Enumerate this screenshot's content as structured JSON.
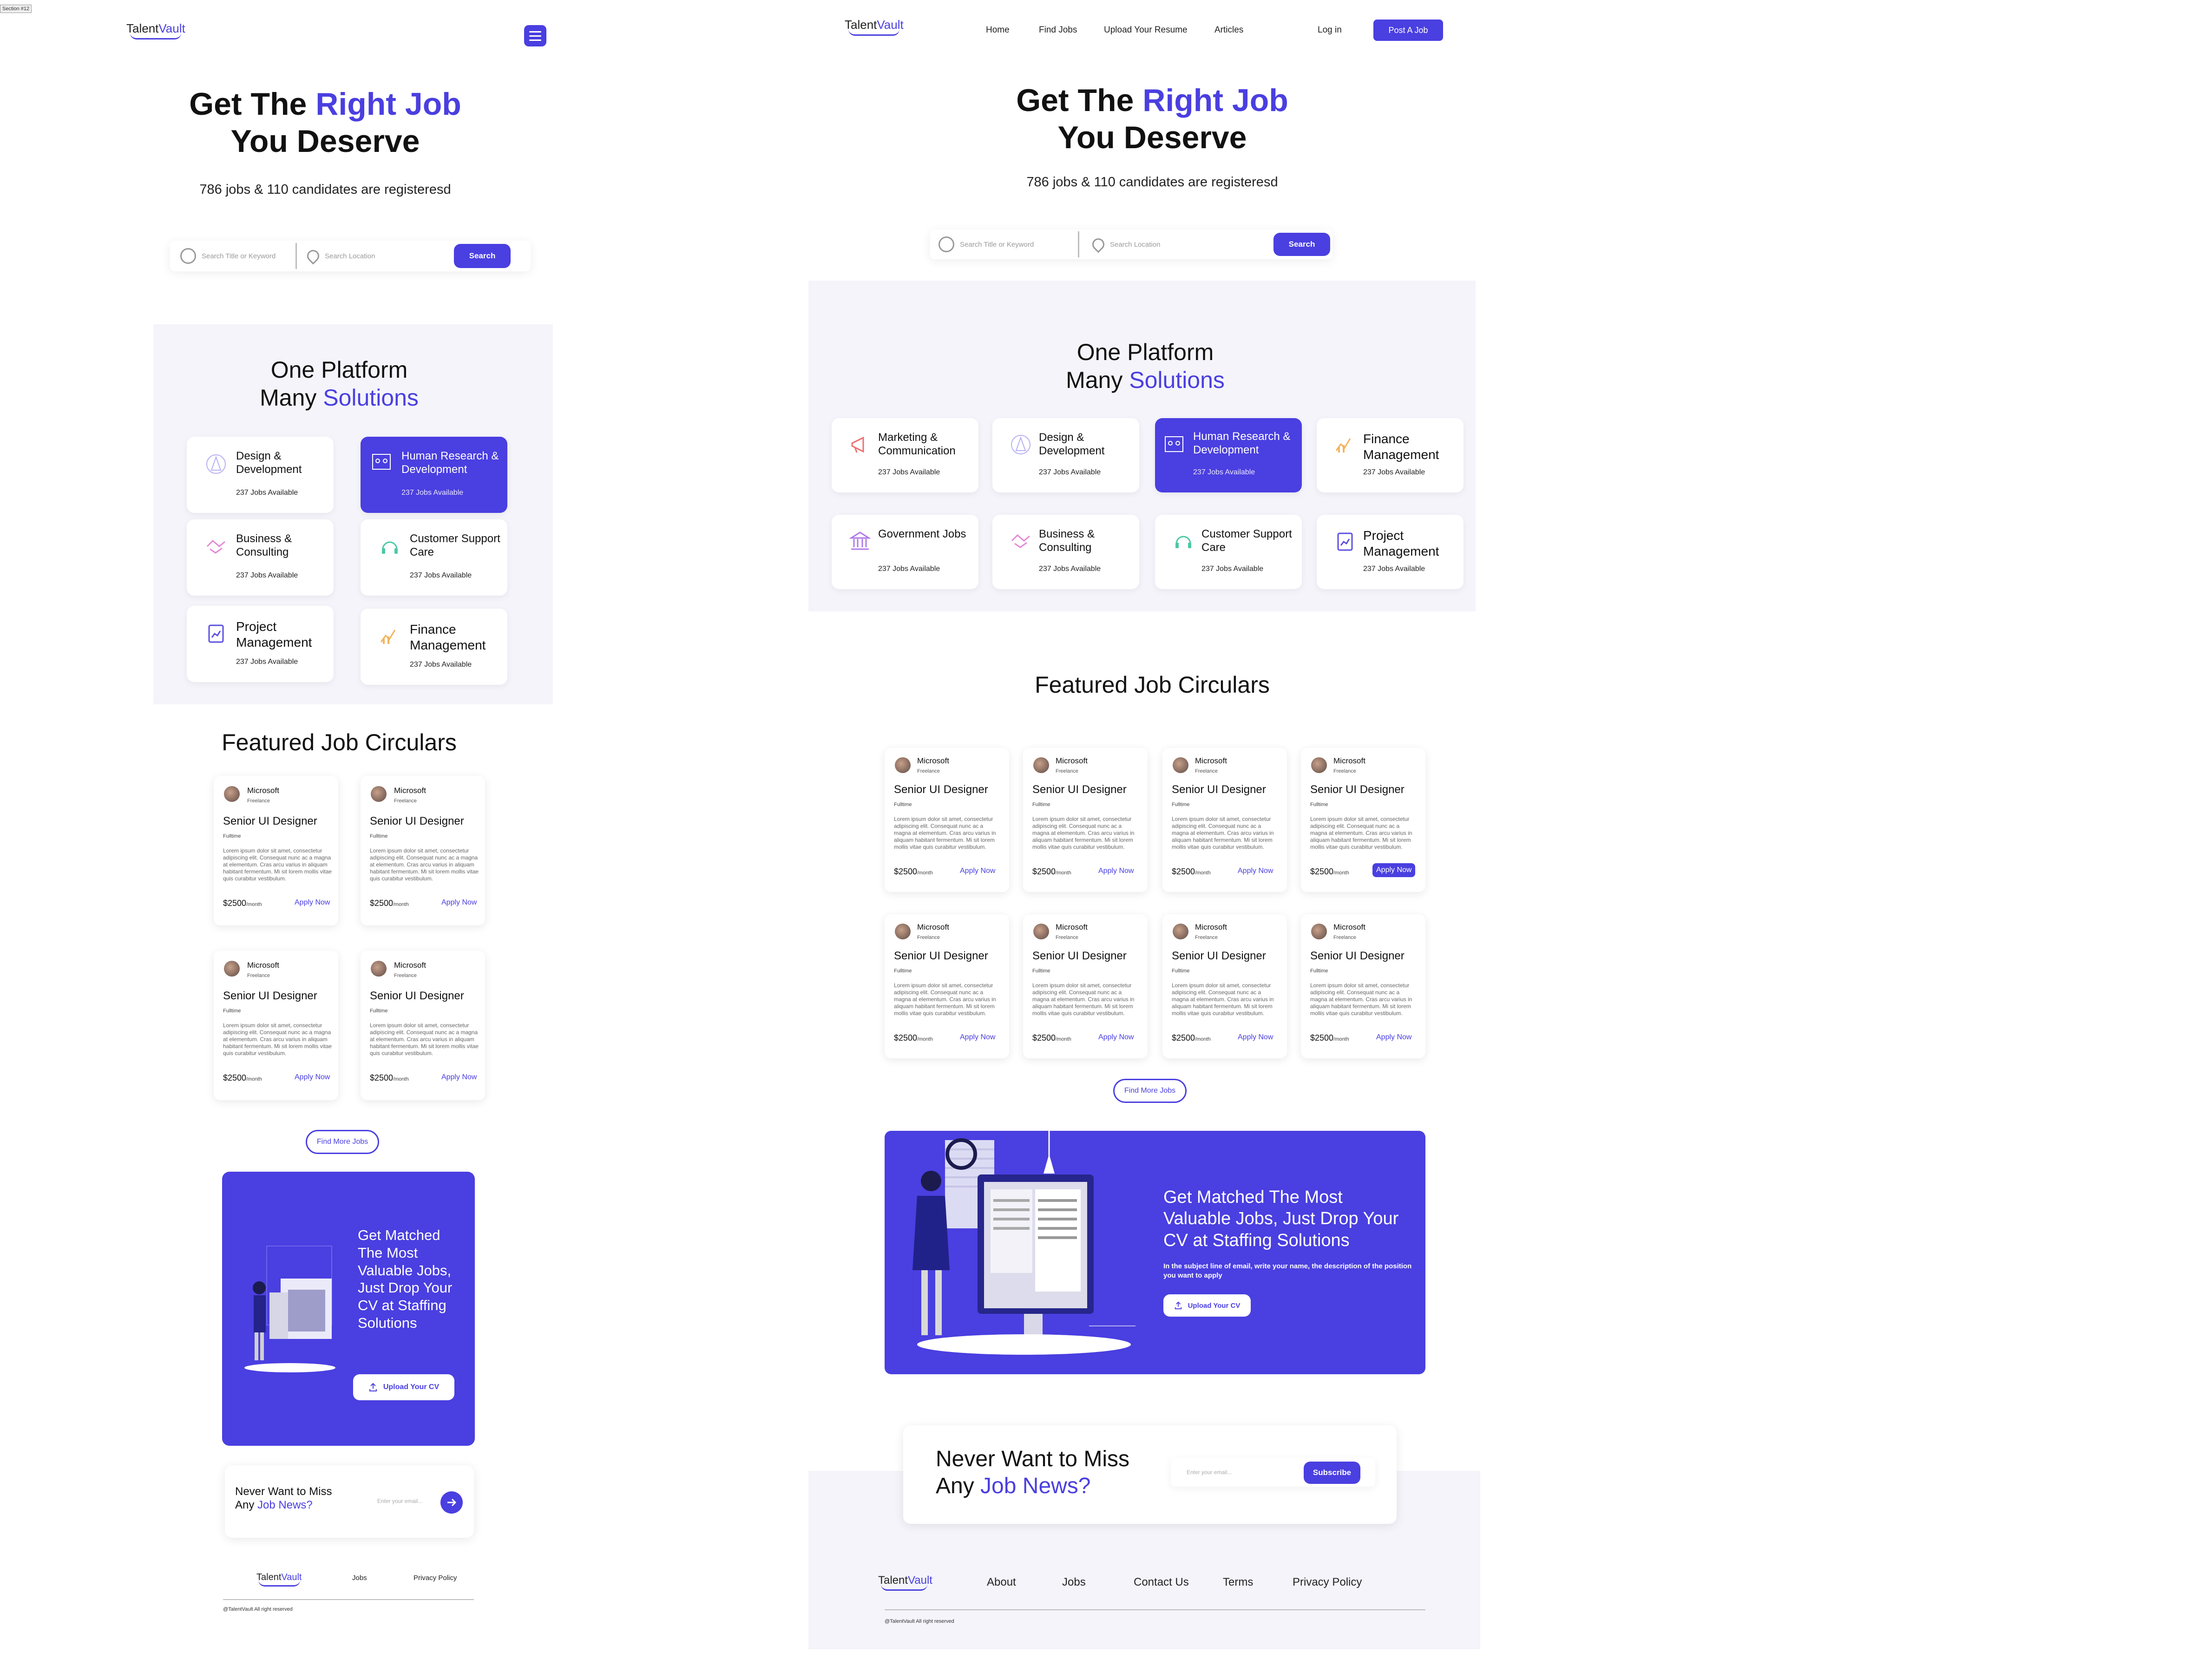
{
  "frame_label": "Section #12",
  "brand": {
    "logo_first": "Talent",
    "logo_second": "Vault",
    "accent": "#4a3fe0"
  },
  "nav": {
    "items": [
      "Home",
      "Find Jobs",
      "Upload Your Resume",
      "Articles"
    ],
    "login": "Log in",
    "post_job": "Post A Job"
  },
  "hero": {
    "line1_pre": "Get The ",
    "line1_accent": "Right Job",
    "line2": "You Deserve",
    "subtitle": "786 jobs & 110 candidates are registeresd"
  },
  "search": {
    "keyword_placeholder": "Search Title or Keyword",
    "location_placeholder": "Search Location",
    "button": "Search"
  },
  "platform": {
    "title_line1": "One Platform",
    "title_line2_pre": "Many ",
    "title_line2_accent": "Solutions",
    "categories": [
      {
        "name": "Marketing & Communication",
        "count": "237 Jobs Available",
        "icon": "megaphone-icon"
      },
      {
        "name": "Design & Development",
        "count": "237 Jobs Available",
        "icon": "design-pen-icon"
      },
      {
        "name": "Human Research & Development",
        "count": "237 Jobs Available",
        "icon": "team-board-icon"
      },
      {
        "name": "Finance Management",
        "count": "237 Jobs Available",
        "icon": "finance-chart-icon"
      },
      {
        "name": "Government Jobs",
        "count": "237 Jobs Available",
        "icon": "government-building-icon"
      },
      {
        "name": "Business & Consulting",
        "count": "237 Jobs Available",
        "icon": "handshake-icon"
      },
      {
        "name": "Customer Support Care",
        "count": "237 Jobs Available",
        "icon": "headset-icon"
      },
      {
        "name": "Project Management",
        "count": "237 Jobs Available",
        "icon": "clipboard-chart-icon"
      }
    ]
  },
  "featured": {
    "title": "Featured Job Circulars",
    "job": {
      "company": "Microsoft",
      "type": "Freelance",
      "title": "Senior UI Designer",
      "time": "Fulltime",
      "desc": "Lorem ipsum dolor sit amet, consectetur adipiscing elit. Consequat nunc ac a magna at elementum. Cras arcu varius in aliquam habitant fermentum. Mi sit lorem mollis vitae quis curabitur vestibulum.",
      "salary": "$2500",
      "per": "/month",
      "apply": "Apply Now"
    },
    "more_button": "Find More Jobs"
  },
  "cv": {
    "title": "Get Matched The Most Valuable Jobs, Just Drop Your CV at Staffing Solutions",
    "note": "In the subject line of email, write your name, the description of the position you want to apply",
    "button": "Upload Your CV"
  },
  "newsletter": {
    "line1": "Never Want to Miss",
    "line2_pre": "Any ",
    "line2_accent": "Job News?",
    "placeholder": "Enter your email...",
    "button": "Subscribe"
  },
  "footer": {
    "links_desktop": [
      "About",
      "Jobs",
      "Contact Us",
      "Terms",
      "Privacy Policy"
    ],
    "links_mobile": [
      "Jobs",
      "Privacy Policy"
    ],
    "copyright": "@TalentVault All right reserved"
  }
}
